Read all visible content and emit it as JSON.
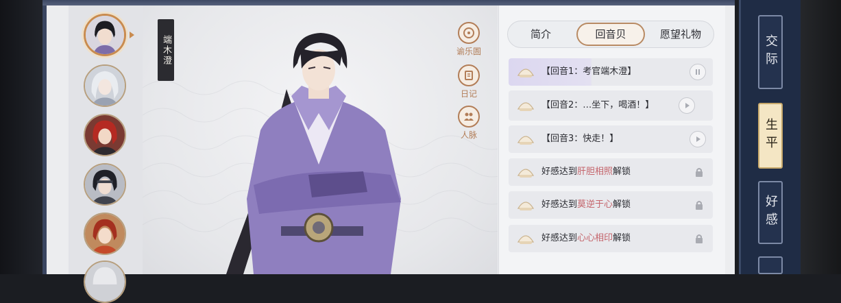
{
  "character": {
    "name": "端木澄"
  },
  "side_actions": [
    {
      "label": "谕乐圄",
      "icon": "music-disc-icon"
    },
    {
      "label": "日记",
      "icon": "diary-icon"
    },
    {
      "label": "人脉",
      "icon": "people-icon"
    }
  ],
  "tabs": [
    {
      "label": "简介",
      "active": false
    },
    {
      "label": "回音贝",
      "active": true
    },
    {
      "label": "愿望礼物",
      "active": false
    }
  ],
  "echo_list": [
    {
      "text": "【回音1：考官端木澄】",
      "state": "playing",
      "control_icon": "pause-icon"
    },
    {
      "text": "【回音2：…坐下，喝酒！】",
      "state": "available",
      "control_icon": "play-icon"
    },
    {
      "text": "【回音3：快走！】",
      "state": "available",
      "control_icon": "play-icon"
    }
  ],
  "locked_list": [
    {
      "prefix": "好感达到",
      "level": "肝胆相照",
      "suffix": "解锁",
      "icon": "lock-icon"
    },
    {
      "prefix": "好感达到",
      "level": "莫逆于心",
      "suffix": "解锁",
      "icon": "lock-icon"
    },
    {
      "prefix": "好感达到",
      "level": "心心相印",
      "suffix": "解锁",
      "icon": "lock-icon"
    }
  ],
  "nav_tabs": [
    {
      "label": "交际",
      "active": false
    },
    {
      "label": "生平",
      "active": true
    },
    {
      "label": "好感",
      "active": false
    }
  ],
  "colors": {
    "accent": "#b88a63",
    "highlight_text": "#c4636a",
    "nav_bg": "#1f2c45"
  }
}
